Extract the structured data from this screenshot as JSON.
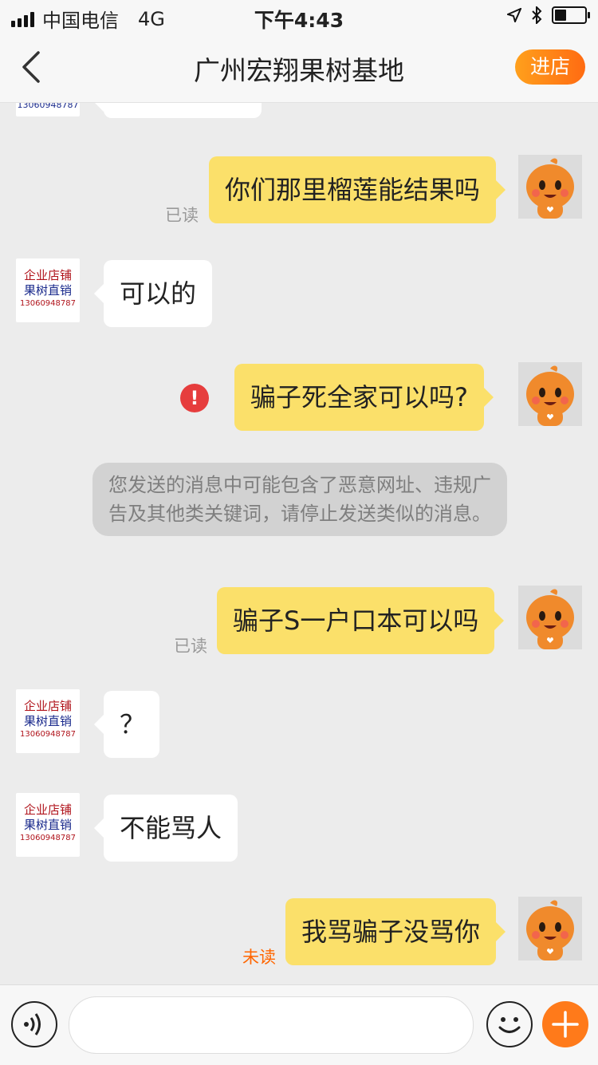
{
  "status_bar": {
    "carrier": "中国电信",
    "network": "4G",
    "time": "下午4:43"
  },
  "header": {
    "title": "广州宏翔果树基地",
    "enter_store_label": "进店"
  },
  "shop_avatar": {
    "line1": "企业店铺",
    "line2": "果树直销",
    "line3": "13060948787"
  },
  "messages": [
    {
      "side": "out",
      "text": "你们那里榴莲能结果吗",
      "status": "已读"
    },
    {
      "side": "in",
      "text": "可以的"
    },
    {
      "side": "out",
      "text": "骗子死全家可以吗?",
      "error_icon": "!"
    },
    {
      "side": "system",
      "text": "您发送的消息中可能包含了恶意网址、违规广告及其他类关键词，请停止发送类似的消息。"
    },
    {
      "side": "out",
      "text": "骗子S一户口本可以吗",
      "status": "已读"
    },
    {
      "side": "in",
      "text": "？"
    },
    {
      "side": "in",
      "text": "不能骂人"
    },
    {
      "side": "out",
      "text": "我骂骗子没骂你",
      "status": "未读"
    }
  ],
  "colors": {
    "accent": "#ff7a1a",
    "bubble_out": "#fbe06a",
    "unread": "#ff6600",
    "error": "#e63d3d"
  }
}
